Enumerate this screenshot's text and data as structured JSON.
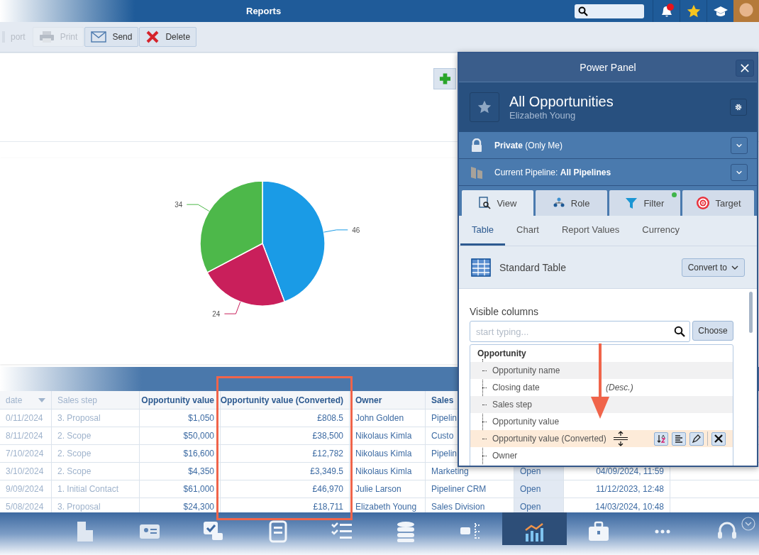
{
  "topbar": {
    "title": "Reports",
    "notifications": {
      "unread": true
    }
  },
  "toolbar": [
    {
      "label": "port",
      "kind": "export",
      "disabled": true
    },
    {
      "label": "Print",
      "kind": "print",
      "disabled": true
    },
    {
      "label": "Send",
      "kind": "send",
      "disabled": false
    },
    {
      "label": "Delete",
      "kind": "delete",
      "disabled": false
    }
  ],
  "chart": {
    "chart_data": {
      "type": "pie",
      "values": [
        46,
        24,
        34
      ],
      "colors": [
        "#1a9be6",
        "#c91f5b",
        "#4db84a"
      ],
      "data_labels": true
    }
  },
  "table": {
    "columns": [
      {
        "label": "date",
        "sorted": true
      },
      {
        "label": "Sales step"
      },
      {
        "label": "Opportunity value"
      },
      {
        "label": "Opportunity value (Converted)"
      },
      {
        "label": "Owner"
      },
      {
        "label": "Sales"
      }
    ],
    "rows": [
      {
        "cells": [
          "0/11/2024",
          "3. Proposal",
          "$1,050",
          "£808.5",
          "John Golden",
          "Pipelin"
        ]
      },
      {
        "cells": [
          "8/11/2024",
          "2. Scope",
          "$50,000",
          "£38,500",
          "Nikolaus Kimla",
          "Custo"
        ]
      },
      {
        "cells": [
          "7/10/2024",
          "2. Scope",
          "$16,600",
          "£12,782",
          "Nikolaus Kimla",
          "Pipelin"
        ]
      },
      {
        "cells": [
          "3/10/2024",
          "2. Scope",
          "$4,350",
          "£3,349.5",
          "Nikolaus Kimla",
          "Marketing",
          "Open",
          "04/09/2024, 11:59"
        ]
      },
      {
        "cells": [
          "9/09/2024",
          "1. Initial Contact",
          "$61,000",
          "£46,970",
          "Julie Larson",
          "Pipeliner CRM",
          "Open",
          "11/12/2023, 12:48"
        ]
      },
      {
        "cells": [
          "5/08/2024",
          "3. Proposal",
          "$24,300",
          "£18,711",
          "Elizabeth Young",
          "Sales Division",
          "Open",
          "14/03/2024, 10:48"
        ]
      }
    ]
  },
  "nav": [
    {
      "kind": "building",
      "selected": false
    },
    {
      "kind": "contact",
      "selected": false
    },
    {
      "kind": "activity",
      "selected": false
    },
    {
      "kind": "quote",
      "selected": false
    },
    {
      "kind": "checklist",
      "selected": false
    },
    {
      "kind": "database",
      "selected": false
    },
    {
      "kind": "feed",
      "selected": false
    },
    {
      "kind": "analytics",
      "selected": true
    },
    {
      "kind": "briefcase",
      "selected": false
    },
    {
      "kind": "more",
      "selected": false
    },
    {
      "kind": "headset",
      "selected": false
    }
  ],
  "panel": {
    "title": "Power Panel",
    "report": {
      "name": "All Opportunities",
      "owner": "Elizabeth Young"
    },
    "settings": [
      {
        "kind": "lock",
        "text": "**Private** (Only Me)"
      },
      {
        "kind": "pipeline",
        "text": "Current Pipeline: **All Pipelines**"
      }
    ],
    "tabs": [
      {
        "label": "View",
        "kind": "view",
        "selected": true,
        "active_dot": false
      },
      {
        "label": "Role",
        "kind": "role",
        "selected": false,
        "active_dot": false
      },
      {
        "label": "Filter",
        "kind": "filter",
        "selected": false,
        "active_dot": true
      },
      {
        "label": "Target",
        "kind": "target",
        "selected": false,
        "active_dot": false
      }
    ],
    "subtabs": [
      {
        "label": "Table",
        "selected": true
      },
      {
        "label": "Chart",
        "selected": false
      },
      {
        "label": "Report Values",
        "selected": false
      },
      {
        "label": "Currency",
        "selected": false
      }
    ],
    "table_type": {
      "label": "Standard Table",
      "button": "Convert to"
    },
    "columns_label": "Visible columns",
    "search": {
      "placeholder": "start typing..."
    },
    "choose_button": "Choose",
    "tree": {
      "label": "Opportunity",
      "children": [
        {
          "label": "Opportunity name",
          "selected": false
        },
        {
          "label": "Closing date",
          "note": "(Desc.)",
          "selected": false
        },
        {
          "label": "Sales step",
          "selected": false
        },
        {
          "label": "Opportunity value",
          "selected": false
        },
        {
          "label": "Opportunity value (Converted)",
          "selected": true
        },
        {
          "label": "Owner",
          "selected": false
        }
      ]
    }
  }
}
